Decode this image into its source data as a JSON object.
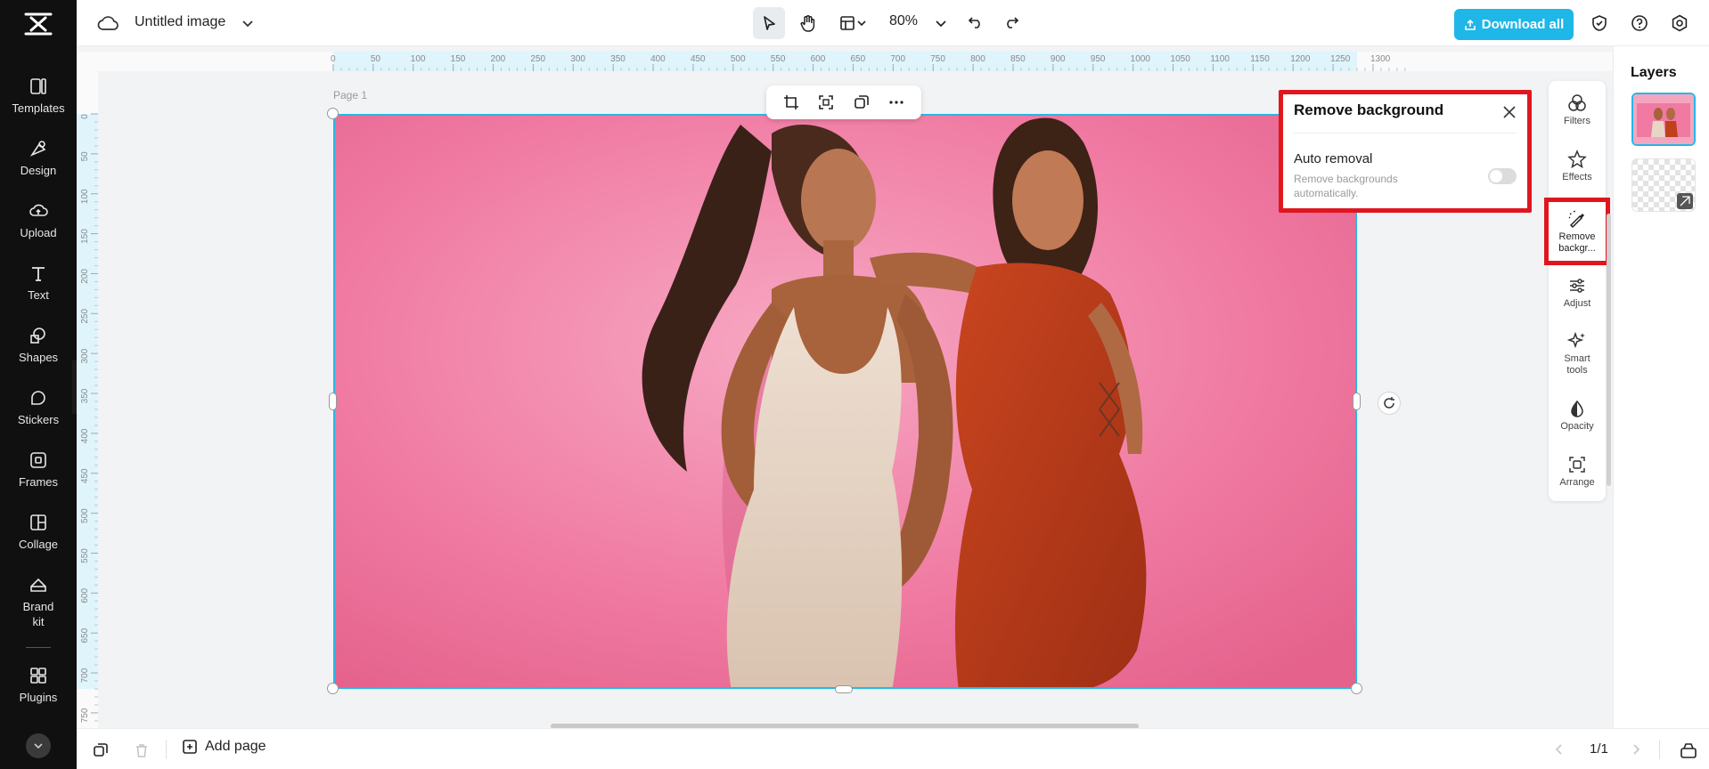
{
  "app": {
    "doc_title": "Untitled image"
  },
  "sidebar": {
    "items": [
      {
        "id": "templates",
        "label": "Templates",
        "icon": "templates-icon"
      },
      {
        "id": "design",
        "label": "Design",
        "icon": "design-icon"
      },
      {
        "id": "upload",
        "label": "Upload",
        "icon": "upload-icon"
      },
      {
        "id": "text",
        "label": "Text",
        "icon": "text-icon"
      },
      {
        "id": "shapes",
        "label": "Shapes",
        "icon": "shapes-icon"
      },
      {
        "id": "stickers",
        "label": "Stickers",
        "icon": "stickers-icon"
      },
      {
        "id": "frames",
        "label": "Frames",
        "icon": "frames-icon"
      },
      {
        "id": "collage",
        "label": "Collage",
        "icon": "collage-icon"
      },
      {
        "id": "brand-kit",
        "label": "Brand\nkit",
        "icon": "brand-kit-icon"
      },
      {
        "id": "plugins",
        "label": "Plugins",
        "icon": "plugins-icon"
      }
    ]
  },
  "toolbar": {
    "zoom": "80%",
    "download_label": "Download all"
  },
  "ruler": {
    "top_ticks": [
      "0",
      "50",
      "100",
      "150",
      "200",
      "250",
      "300",
      "350",
      "400",
      "450",
      "500",
      "550",
      "600",
      "650",
      "700",
      "750",
      "800",
      "850",
      "900",
      "950",
      "1000",
      "1050",
      "1100",
      "1150",
      "1200",
      "1250",
      "1300"
    ],
    "left_ticks": [
      "0",
      "50",
      "100",
      "150",
      "200",
      "250",
      "300",
      "350",
      "400",
      "450",
      "500",
      "550",
      "600",
      "650",
      "700",
      "750"
    ]
  },
  "canvas": {
    "page_label": "Page 1"
  },
  "remove_bg": {
    "title": "Remove background",
    "auto_label": "Auto removal",
    "auto_desc": "Remove backgrounds automatically.",
    "auto_enabled": false
  },
  "tools": [
    {
      "id": "filters",
      "label": "Filters",
      "icon": "filters-icon"
    },
    {
      "id": "effects",
      "label": "Effects",
      "icon": "effects-icon"
    },
    {
      "id": "remove-bg",
      "label": "Remove backgr...",
      "icon": "remove-background-icon"
    },
    {
      "id": "adjust",
      "label": "Adjust",
      "icon": "adjust-icon"
    },
    {
      "id": "smart-tools",
      "label": "Smart tools",
      "icon": "smart-tools-icon"
    },
    {
      "id": "opacity",
      "label": "Opacity",
      "icon": "opacity-icon"
    },
    {
      "id": "arrange",
      "label": "Arrange",
      "icon": "arrange-icon"
    }
  ],
  "layers": {
    "title": "Layers"
  },
  "bottom": {
    "add_page_label": "Add page",
    "page_counter": "1/1"
  },
  "colors": {
    "accent": "#1fb6e8",
    "highlight": "#e0161f",
    "sidebar_bg": "#101010",
    "canvas_pink": "#f27fa4"
  }
}
